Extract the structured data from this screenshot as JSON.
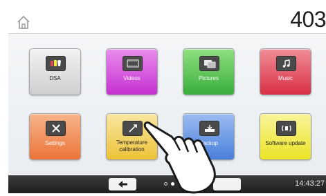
{
  "header": {
    "temperature_value": "403",
    "temperature_unit": "°"
  },
  "tiles": [
    {
      "label": "DSA",
      "icon": "dsa-icon",
      "color": "#d9d9d9"
    },
    {
      "label": "Videos",
      "icon": "video-icon",
      "color": "#d84fe0"
    },
    {
      "label": "Pictures",
      "icon": "pictures-icon",
      "color": "#49c24c"
    },
    {
      "label": "Music",
      "icon": "music-icon",
      "color": "#e0495a"
    },
    {
      "label": "Settings",
      "icon": "settings-icon",
      "color": "#f08a4f"
    },
    {
      "label": "Temperature calibration",
      "icon": "calibration-icon",
      "color": "#f2d052"
    },
    {
      "label": "Backup",
      "icon": "backup-icon",
      "color": "#5a8de0"
    },
    {
      "label": "Software update",
      "icon": "software-update-icon",
      "color": "#f0ea3c"
    }
  ],
  "footer": {
    "time": "14:43:27",
    "back_icon": "arrow-left-icon",
    "page_count": 3,
    "active_page": 2
  }
}
